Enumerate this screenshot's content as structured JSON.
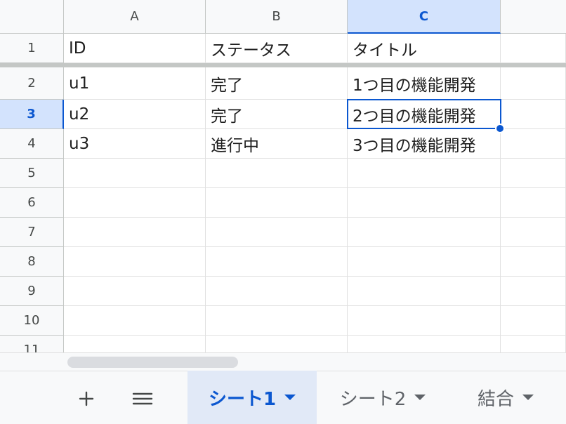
{
  "columns": [
    "A",
    "B",
    "C"
  ],
  "rows": [
    "1",
    "2",
    "3",
    "4",
    "5",
    "6",
    "7",
    "8",
    "9",
    "10",
    "11"
  ],
  "cells": [
    [
      "ID",
      "ステータス",
      "タイトル"
    ],
    [
      "u1",
      "完了",
      "1つ目の機能開発"
    ],
    [
      "u2",
      "完了",
      "2つ目の機能開発"
    ],
    [
      "u3",
      "進行中",
      "3つ目の機能開発"
    ]
  ],
  "selection": {
    "column": "C",
    "row": "3"
  },
  "tabs": {
    "add_icon": "plus-icon",
    "list_icon": "hamburger-menu-icon",
    "items": [
      {
        "label": "シート1",
        "active": true
      },
      {
        "label": "シート2",
        "active": false
      },
      {
        "label": "結合",
        "active": false
      }
    ]
  },
  "colors": {
    "accent": "#0b57d0",
    "header_bg": "#f8f9fa",
    "selected_header_bg": "#d3e3fd",
    "grid_line": "#e1e1e1"
  }
}
